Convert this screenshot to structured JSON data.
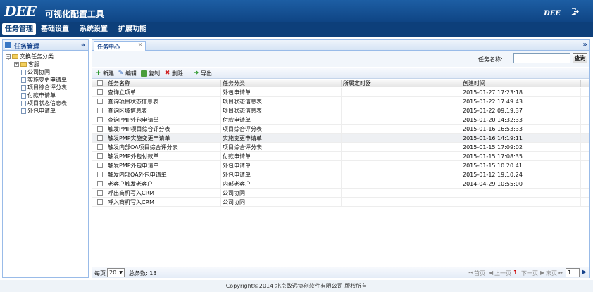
{
  "header": {
    "logo": "DEE",
    "title": "可视化配置工具",
    "small_logo": "DEE",
    "exit_icon": "logout-icon"
  },
  "nav": [
    {
      "label": "任务管理",
      "active": true
    },
    {
      "label": "基础设置",
      "active": false
    },
    {
      "label": "系统设置",
      "active": false
    },
    {
      "label": "扩展功能",
      "active": false
    }
  ],
  "left_panel": {
    "title": "任务管理",
    "collapse_icon": "«",
    "tree": {
      "root": "交换任务分类",
      "folder": "客服",
      "items": [
        "公司协同",
        "实施变更申请单",
        "项目综合评分表",
        "付款申请单",
        "项目状态信息表",
        "外包申请单"
      ]
    }
  },
  "tab": {
    "label": "任务中心",
    "close": "×",
    "scroll": "»"
  },
  "search": {
    "label": "任务名称:",
    "value": "",
    "button": "查询"
  },
  "toolbar": {
    "new": "新建",
    "edit": "编辑",
    "copy": "复制",
    "delete": "删除",
    "export": "导出"
  },
  "table": {
    "columns": [
      "任务名称",
      "任务分类",
      "所属定时器",
      "创建时间"
    ],
    "rows": [
      [
        "查询立项单",
        "外包申请单",
        "",
        "2015-01-27 17:23:18"
      ],
      [
        "查询项目状态信息表",
        "项目状态信息表",
        "",
        "2015-01-22 17:49:43"
      ],
      [
        "查询区域信息表",
        "项目状态信息表",
        "",
        "2015-01-22 09:19:37"
      ],
      [
        "查询PMP外包申请单",
        "付款申请单",
        "",
        "2015-01-20 14:32:33"
      ],
      [
        "触发PMP项目综合评分表",
        "项目综合评分表",
        "",
        "2015-01-16 16:53:33"
      ],
      [
        "触发PMP实施变更申请单",
        "实施变更申请单",
        "",
        "2015-01-16 14:19:11"
      ],
      [
        "触发内部OA项目综合评分表",
        "项目综合评分表",
        "",
        "2015-01-15 17:09:02"
      ],
      [
        "触发PMP外包付款单",
        "付款申请单",
        "",
        "2015-01-15 17:08:35"
      ],
      [
        "触发PMP外包申请单",
        "外包申请单",
        "",
        "2015-01-15 10:20:41"
      ],
      [
        "触发内部OA外包申请单",
        "外包申请单",
        "",
        "2015-01-12 19:10:24"
      ],
      [
        "老客户触发老客户",
        "内部老客户",
        "",
        "2014-04-29 10:55:00"
      ],
      [
        "呼出商机写入CRM",
        "公司协同",
        "",
        ""
      ],
      [
        "呼入商机写入CRM",
        "公司协同",
        "",
        ""
      ]
    ],
    "selected_row": 5
  },
  "pager": {
    "per_page_label": "每页",
    "per_page": "20",
    "total_label": "总条数: 13",
    "first": "首页",
    "prev": "上一页",
    "current": "1",
    "next": "下一页",
    "last": "末页",
    "page_input": "1"
  },
  "footer": "Copyright©2014 北京致远协创软件有限公司 版权所有"
}
